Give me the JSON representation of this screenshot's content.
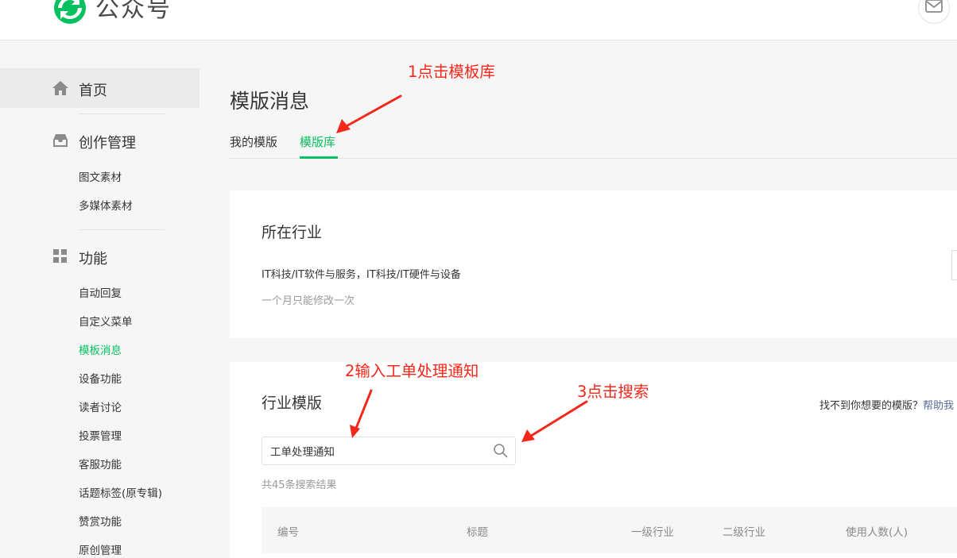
{
  "header": {
    "brand": "公众号",
    "logo_icon": "wechat-mp-logo-icon",
    "mail_icon": "mail-icon",
    "accent": "#07c160"
  },
  "sidebar": {
    "home": {
      "label": "首页",
      "icon": "home-icon"
    },
    "creation": {
      "label": "创作管理",
      "icon": "inbox-icon",
      "items": [
        "图文素材",
        "多媒体素材"
      ]
    },
    "features": {
      "label": "功能",
      "icon": "grid-icon",
      "items": [
        "自动回复",
        "自定义菜单",
        "模板消息",
        "设备功能",
        "读者讨论",
        "投票管理",
        "客服功能",
        "话题标签(原专辑)",
        "赞赏功能",
        "原创管理"
      ],
      "active_index": 2
    }
  },
  "main": {
    "title": "模版消息",
    "tabs": [
      {
        "label": "我的模版",
        "active": false
      },
      {
        "label": "模版库",
        "active": true
      }
    ],
    "industry_card": {
      "title": "所在行业",
      "industry": "IT科技/IT软件与服务，IT科技/IT硬件与设备",
      "note": "一个月只能修改一次"
    },
    "template_card": {
      "title": "行业模版",
      "help_text": "找不到你想要的模版？",
      "help_link": "帮助我",
      "search_value": "工单处理通知",
      "search_icon": "search-icon",
      "result_count": "共45条搜索结果",
      "columns": [
        "编号",
        "标题",
        "一级行业",
        "二级行业",
        "使用人数(人)"
      ]
    }
  },
  "annotations": {
    "step1": "1点击模板库",
    "step2": "2输入工单处理通知",
    "step3": "3点击搜索",
    "color": "#f5271b"
  }
}
